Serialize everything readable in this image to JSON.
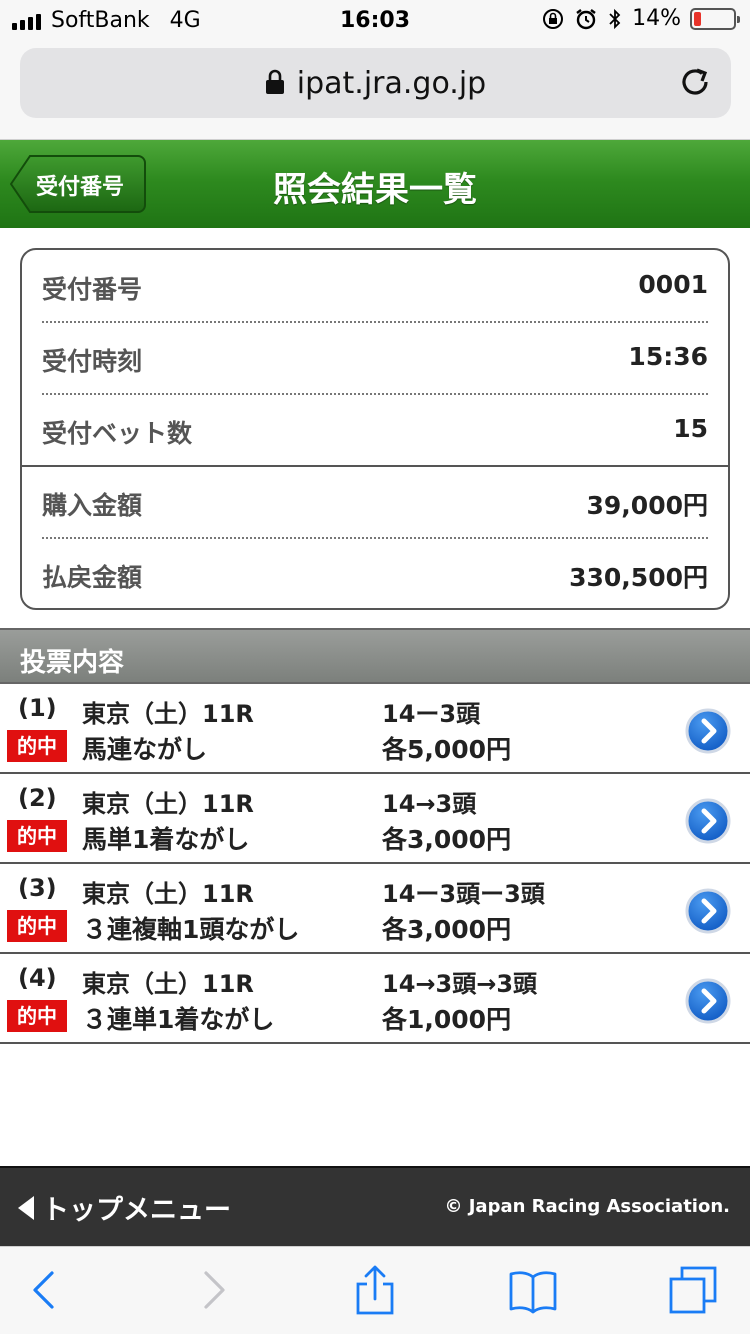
{
  "status_bar": {
    "carrier": "SoftBank",
    "network": "4G",
    "time": "16:03",
    "battery_percent": "14%",
    "battery_level": 0.14
  },
  "browser": {
    "url": "ipat.jra.go.jp"
  },
  "header": {
    "back_label": "受付番号",
    "title": "照会結果一覧",
    "color": "#2e8a1f"
  },
  "summary": {
    "rows": [
      {
        "label": "受付番号",
        "value": "0001"
      },
      {
        "label": "受付時刻",
        "value": "15:36"
      },
      {
        "label": "受付ベット数",
        "value": "15"
      },
      {
        "label": "購入金額",
        "value": "39,000円"
      },
      {
        "label": "払戻金額",
        "value": "330,500円"
      }
    ]
  },
  "section": {
    "title": "投票内容"
  },
  "bets": [
    {
      "num": "(1)",
      "race": "東京（土）11R",
      "badge": "的中",
      "type": "馬連ながし",
      "combo": "14ー3頭",
      "amount": "各5,000円"
    },
    {
      "num": "(2)",
      "race": "東京（土）11R",
      "badge": "的中",
      "type": "馬単1着ながし",
      "combo": "14→3頭",
      "amount": "各3,000円"
    },
    {
      "num": "(3)",
      "race": "東京（土）11R",
      "badge": "的中",
      "type": "３連複軸1頭ながし",
      "combo": "14ー3頭ー3頭",
      "amount": "各3,000円"
    },
    {
      "num": "(4)",
      "race": "東京（土）11R",
      "badge": "的中",
      "type": "３連単1着ながし",
      "combo": "14→3頭→3頭",
      "amount": "各1,000円"
    }
  ],
  "footer": {
    "top_menu_label": "トップメニュー",
    "copyright": "© Japan Racing Association."
  },
  "icons": {
    "lock": "lock-icon",
    "reload": "reload-icon",
    "detail": "chevron-right-circle-icon",
    "back": "back-arrow-icon",
    "forward": "forward-arrow-icon",
    "share": "share-icon",
    "bookmarks": "bookmarks-icon",
    "tabs": "tabs-icon"
  }
}
